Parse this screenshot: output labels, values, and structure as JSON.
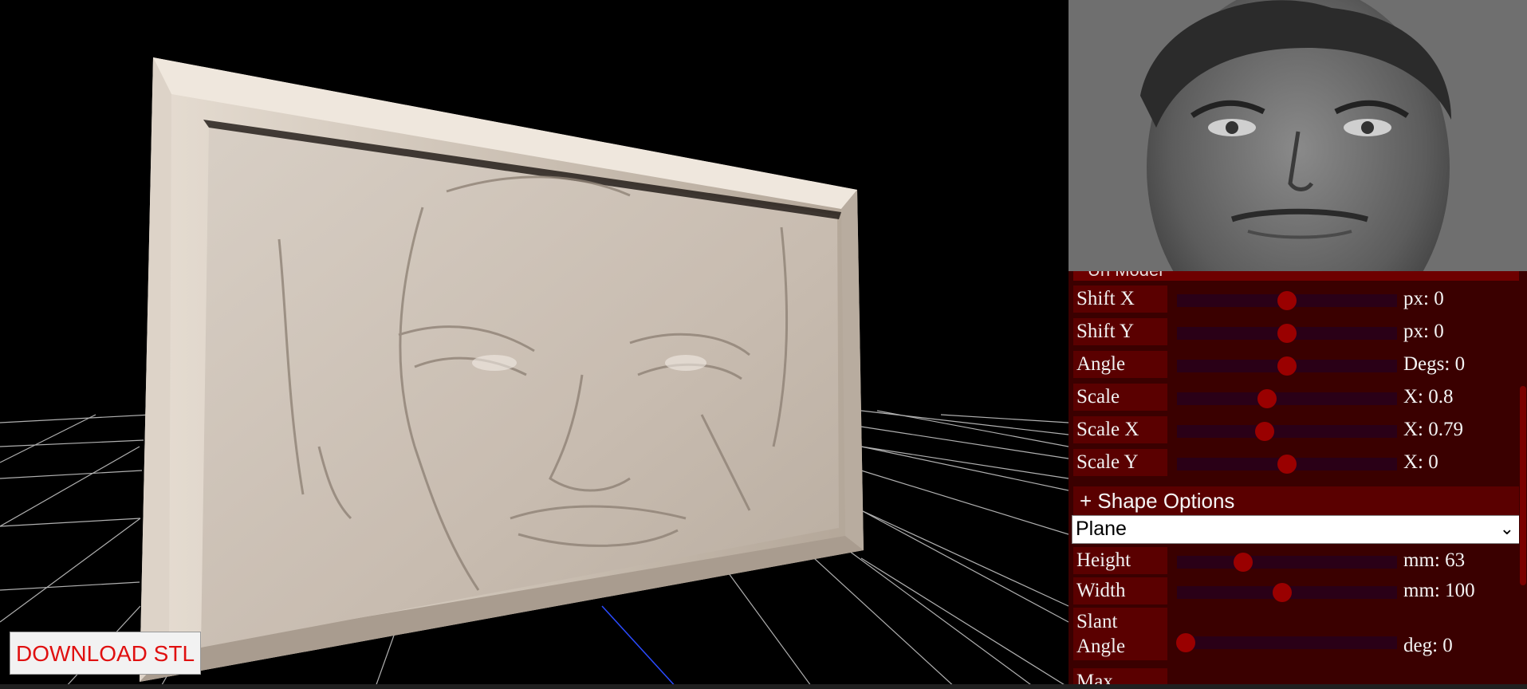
{
  "download_button": {
    "label": "DOWNLOAD STL"
  },
  "model_section": {
    "label": "Un Model"
  },
  "sliders_model": [
    {
      "label": "Shift X",
      "value_text": "px: 0",
      "fraction": 0.5
    },
    {
      "label": "Shift Y",
      "value_text": "px: 0",
      "fraction": 0.5
    },
    {
      "label": "Angle",
      "value_text": "Degs: 0",
      "fraction": 0.5
    },
    {
      "label": "Scale",
      "value_text": "X: 0.8",
      "fraction": 0.41
    },
    {
      "label": "Scale X",
      "value_text": "X: 0.79",
      "fraction": 0.4
    },
    {
      "label": "Scale Y",
      "value_text": "X: 0",
      "fraction": 0.5
    }
  ],
  "shape_section": {
    "label": "+ Shape Options"
  },
  "shape_select": {
    "selected": "Plane"
  },
  "sliders_shape": [
    {
      "label": "Height",
      "value_text": "mm: 63",
      "fraction": 0.3
    },
    {
      "label": "Width",
      "value_text": "mm: 100",
      "fraction": 0.48
    },
    {
      "label": "Slant Angle",
      "value_text": "deg: 0",
      "fraction": 0.04
    },
    {
      "label": "Max",
      "value_text": "",
      "fraction": null
    }
  ],
  "colors": {
    "panel_bg": "#3a0000",
    "label_bg": "#5a0000",
    "track": "#2a0017",
    "thumb": "#9a0000",
    "download_text": "#e01010",
    "model_surface": "#c9bdb0"
  },
  "icons": {
    "select_chevron": "chevron-down-icon"
  }
}
